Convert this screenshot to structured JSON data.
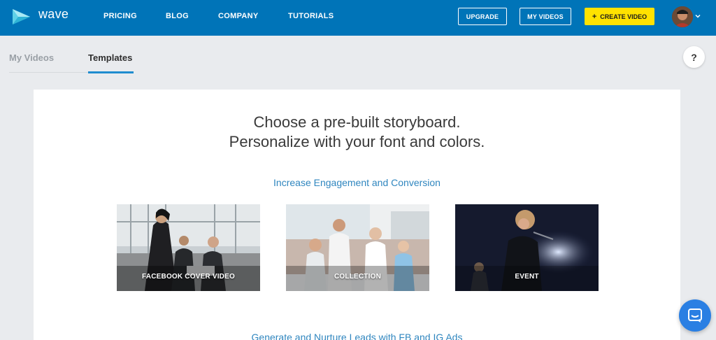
{
  "header": {
    "brand": "wave",
    "nav": [
      "PRICING",
      "BLOG",
      "COMPANY",
      "TUTORIALS"
    ],
    "upgrade_label": "UPGRADE",
    "my_videos_label": "MY VIDEOS",
    "create_video_label": "CREATE VIDEO",
    "create_video_icon": "+",
    "colors": {
      "bar": "#0074b8",
      "create_button": "#ffe200"
    }
  },
  "tabs": [
    {
      "label": "My Videos",
      "active": false
    },
    {
      "label": "Templates",
      "active": true
    }
  ],
  "help_label": "?",
  "main": {
    "headline_line1": "Choose a pre-built storyboard.",
    "headline_line2": "Personalize with your font and colors.",
    "section1_title": "Increase Engagement and Conversion",
    "section2_title": "Generate and Nurture Leads with FB and IG Ads",
    "templates": [
      {
        "label": "FACEBOOK COVER VIDEO"
      },
      {
        "label": "COLLECTION"
      },
      {
        "label": "EVENT"
      }
    ]
  },
  "icons": [
    "wave-logo-icon",
    "chevron-down-icon",
    "help-icon",
    "chat-icon"
  ]
}
